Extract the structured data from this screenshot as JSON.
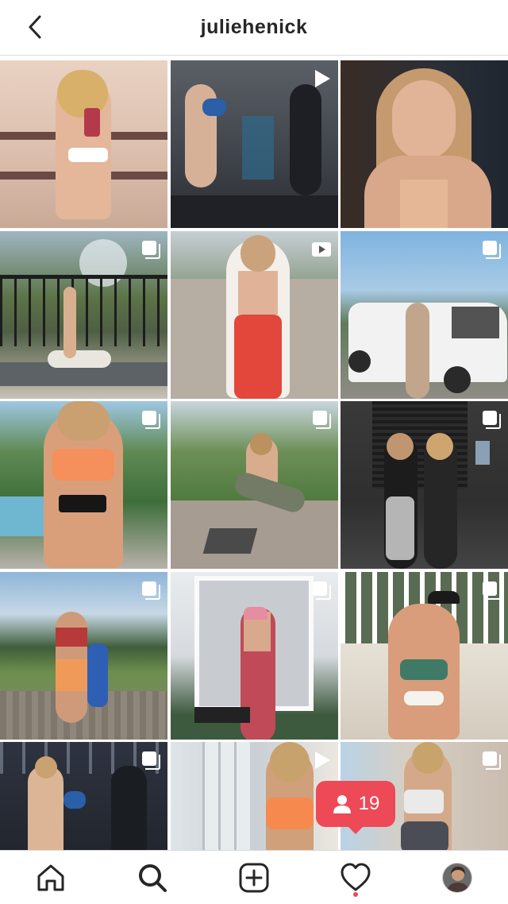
{
  "header": {
    "username": "juliehenick"
  },
  "posts": [
    {
      "badge": "none"
    },
    {
      "badge": "video"
    },
    {
      "badge": "none"
    },
    {
      "badge": "carousel"
    },
    {
      "badge": "video"
    },
    {
      "badge": "carousel"
    },
    {
      "badge": "carousel"
    },
    {
      "badge": "carousel"
    },
    {
      "badge": "carousel"
    },
    {
      "badge": "carousel"
    },
    {
      "badge": "carousel"
    },
    {
      "badge": "carousel"
    },
    {
      "badge": "carousel"
    },
    {
      "badge": "video"
    },
    {
      "badge": "carousel"
    }
  ],
  "notification": {
    "count": "19",
    "icon": "person-icon",
    "color": "#ed4956"
  },
  "nav": {
    "items": [
      "home-icon",
      "search-icon",
      "new-post-icon",
      "activity-heart-icon",
      "profile-avatar"
    ],
    "active": "search-icon"
  }
}
